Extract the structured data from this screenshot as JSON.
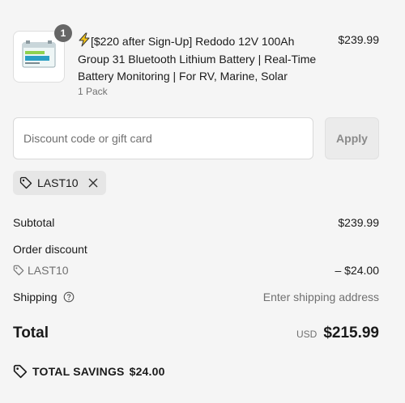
{
  "product": {
    "quantity_badge": "1",
    "title": "[$220 after Sign-Up] Redodo 12V 100Ah Group 31 Bluetooth Lithium Battery | Real-Time Battery Monitoring | For RV, Marine, Solar",
    "variant": "1 Pack",
    "price": "$239.99"
  },
  "discount": {
    "placeholder": "Discount code or gift card",
    "value": "",
    "apply_label": "Apply",
    "applied_code": "LAST10"
  },
  "summary": {
    "subtotal_label": "Subtotal",
    "subtotal_value": "$239.99",
    "order_discount_label": "Order discount",
    "discount_code": "LAST10",
    "discount_value": "– $24.00",
    "shipping_label": "Shipping",
    "shipping_value": "Enter shipping address",
    "total_label": "Total",
    "currency": "USD",
    "total_value": "$215.99",
    "savings_label": "TOTAL SAVINGS",
    "savings_value": "$24.00"
  },
  "icons": {
    "bolt": "lightning-bolt-icon",
    "tag": "tag-icon",
    "remove": "close-icon",
    "help": "question-circle-icon"
  },
  "colors": {
    "background": "#f5f5f5",
    "badge": "#666666",
    "muted_text": "#707070",
    "bolt_fill": "#f5c518"
  }
}
